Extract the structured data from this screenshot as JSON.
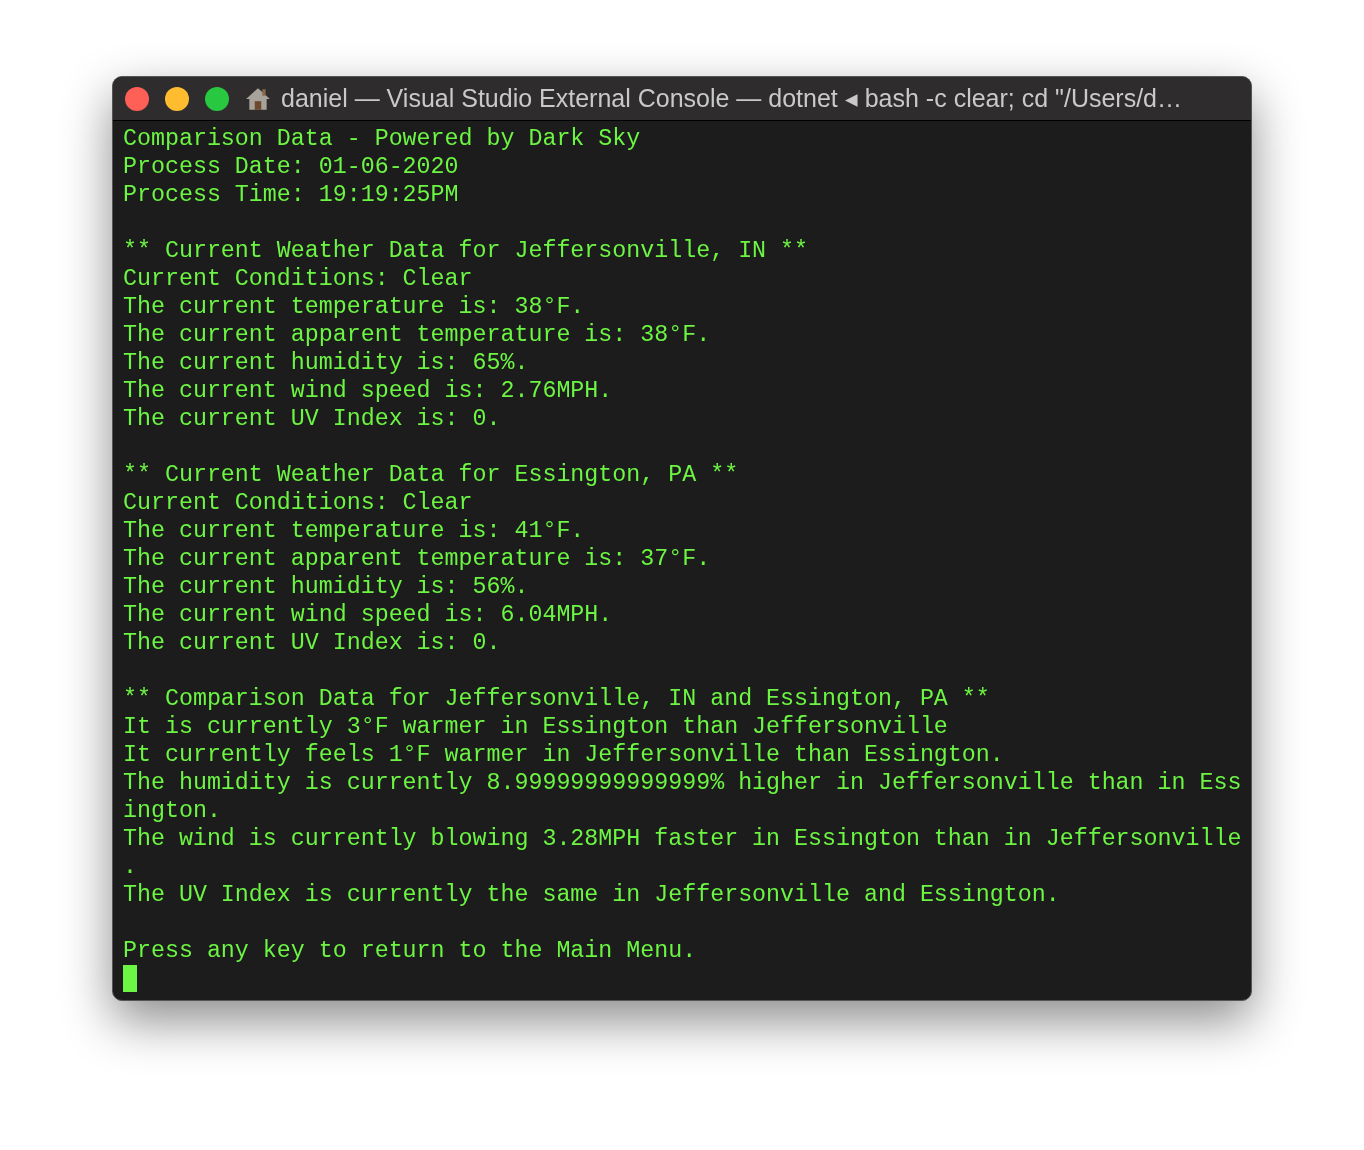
{
  "window": {
    "title": "daniel — Visual Studio External Console — dotnet ◂ bash -c clear; cd \"/Users/d…"
  },
  "console": {
    "blocks": [
      {
        "lines": [
          "Comparison Data - Powered by Dark Sky",
          "Process Date: 01-06-2020",
          "Process Time: 19:19:25PM"
        ]
      },
      {
        "lines": [
          "** Current Weather Data for Jeffersonville, IN **",
          "Current Conditions: Clear",
          "The current temperature is: 38°F.",
          "The current apparent temperature is: 38°F.",
          "The current humidity is: 65%.",
          "The current wind speed is: 2.76MPH.",
          "The current UV Index is: 0."
        ]
      },
      {
        "lines": [
          "** Current Weather Data for Essington, PA **",
          "Current Conditions: Clear",
          "The current temperature is: 41°F.",
          "The current apparent temperature is: 37°F.",
          "The current humidity is: 56%.",
          "The current wind speed is: 6.04MPH.",
          "The current UV Index is: 0."
        ]
      },
      {
        "lines": [
          "** Comparison Data for Jeffersonville, IN and Essington, PA **",
          "It is currently 3°F warmer in Essington than Jeffersonville",
          "It currently feels 1°F warmer in Jeffersonville than Essington.",
          "The humidity is currently 8.99999999999999% higher in Jeffersonville than in Ess",
          "ington.",
          "The wind is currently blowing 3.28MPH faster in Essington than in Jeffersonville",
          ".",
          "The UV Index is currently the same in Jeffersonville and Essington."
        ]
      },
      {
        "lines": [
          "Press any key to return to the Main Menu."
        ]
      }
    ]
  }
}
